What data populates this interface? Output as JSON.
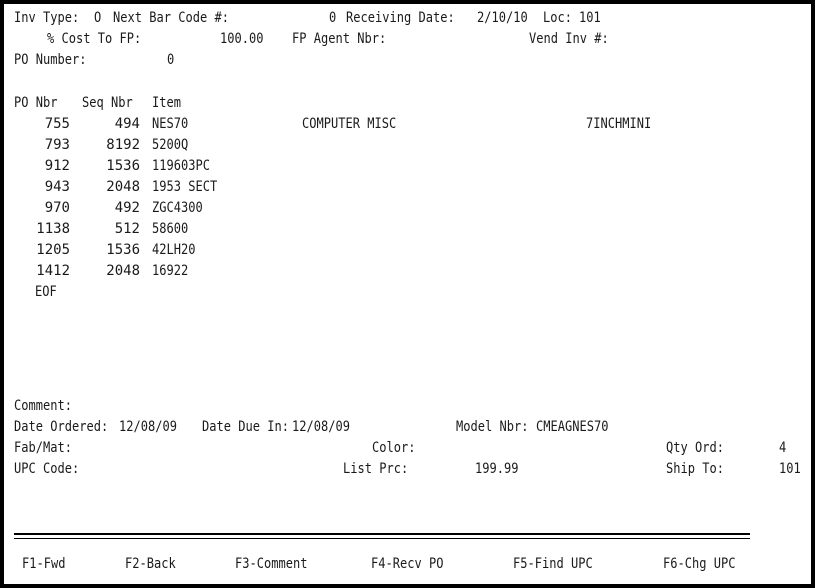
{
  "header": {
    "inv_type_label": "Inv Type:",
    "inv_type_value": "O",
    "next_bar_code_label": "Next Bar Code #:",
    "next_bar_code_value": "0",
    "receiving_date_label": "Receiving Date:",
    "receiving_date_value": "2/10/10",
    "loc_label": "Loc:",
    "loc_value": "101",
    "cost_to_fp_label": "% Cost To FP:",
    "cost_to_fp_value": "100.00",
    "fp_agent_label": "FP Agent Nbr:",
    "vend_inv_label": "Vend Inv #:",
    "po_number_label": "PO Number:",
    "po_number_value": "0"
  },
  "table": {
    "headers": [
      "PO Nbr",
      "Seq Nbr",
      "Item"
    ],
    "rows": [
      {
        "po": "755",
        "seq": "494",
        "item": "NES70",
        "desc": "COMPUTER MISC",
        "model": "7INCHMINI"
      },
      {
        "po": "793",
        "seq": "8192",
        "item": "5200Q",
        "desc": "",
        "model": ""
      },
      {
        "po": "912",
        "seq": "1536",
        "item": "119603PC",
        "desc": "",
        "model": ""
      },
      {
        "po": "943",
        "seq": "2048",
        "item": "1953 SECT",
        "desc": "",
        "model": ""
      },
      {
        "po": "970",
        "seq": "492",
        "item": "ZGC4300",
        "desc": "",
        "model": ""
      },
      {
        "po": "1138",
        "seq": "512",
        "item": "58600",
        "desc": "",
        "model": ""
      },
      {
        "po": "1205",
        "seq": "1536",
        "item": "42LH20",
        "desc": "",
        "model": ""
      },
      {
        "po": "1412",
        "seq": "2048",
        "item": "16922",
        "desc": "",
        "model": ""
      }
    ],
    "eof_label": "EOF"
  },
  "details": {
    "comment_label": "Comment:",
    "date_ordered_label": "Date Ordered:",
    "date_ordered_value": "12/08/09",
    "date_due_label": "Date Due In:",
    "date_due_value": "12/08/09",
    "model_label": "Model Nbr:",
    "model_value": "CMEAGNES70",
    "fab_mat_label": "Fab/Mat:",
    "color_label": "Color:",
    "qty_ord_label": "Qty Ord:",
    "qty_ord_value": "4",
    "upc_label": "UPC Code:",
    "list_prc_label": "List Prc:",
    "list_prc_value": "199.99",
    "ship_to_label": "Ship To:",
    "ship_to_value": "101"
  },
  "function_keys": [
    {
      "label": "F1-Fwd"
    },
    {
      "label": "F2-Back"
    },
    {
      "label": "F3-Comment"
    },
    {
      "label": "F4-Recv PO"
    },
    {
      "label": "F5-Find UPC"
    },
    {
      "label": "F6-Chg UPC"
    }
  ]
}
